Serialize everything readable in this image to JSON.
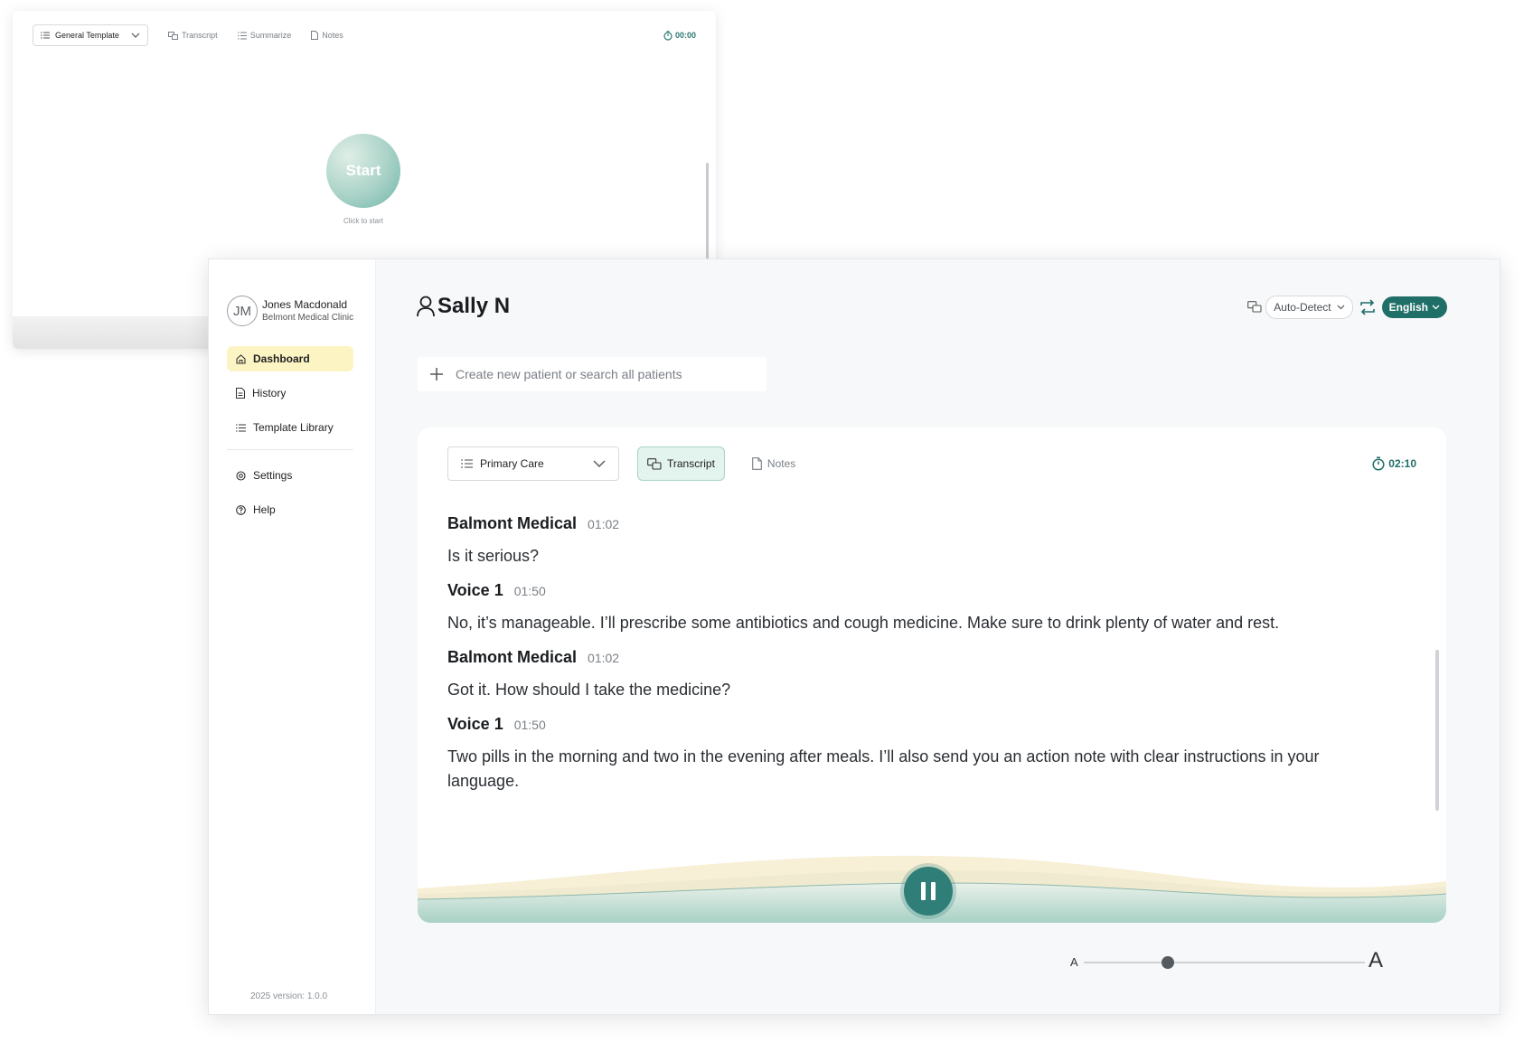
{
  "background_window": {
    "template_select": "General Template",
    "tabs": [
      {
        "label": "Transcript",
        "icon": "transcript-icon"
      },
      {
        "label": "Summarize",
        "icon": "list-icon"
      },
      {
        "label": "Notes",
        "icon": "document-icon"
      }
    ],
    "timer": "00:00",
    "start_button": "Start",
    "start_hint": "Click to start"
  },
  "sidebar": {
    "avatar_initials": "JM",
    "user_name": "Jones Macdonald",
    "clinic": "Belmont Medical Clinic",
    "nav": [
      {
        "label": "Dashboard",
        "icon": "home-icon",
        "active": true
      },
      {
        "label": "History",
        "icon": "history-icon",
        "active": false
      },
      {
        "label": "Template Library",
        "icon": "list-icon",
        "active": false
      }
    ],
    "nav_secondary": [
      {
        "label": "Settings",
        "icon": "gear-icon"
      },
      {
        "label": "Help",
        "icon": "help-icon"
      }
    ],
    "version": "2025 version: 1.0.0"
  },
  "header": {
    "patient_name": "Sally N",
    "source_language": "Auto-Detect",
    "target_language": "English"
  },
  "search": {
    "placeholder": "Create new patient or search all patients"
  },
  "card": {
    "template_select": "Primary Care",
    "tabs": [
      {
        "label": "Transcript",
        "active": true
      },
      {
        "label": "Notes",
        "active": false
      }
    ],
    "timer": "02:10",
    "transcript": [
      {
        "speaker": "Balmont Medical",
        "time": "01:02",
        "text": "Is it serious?"
      },
      {
        "speaker": "Voice 1",
        "time": "01:50",
        "text": "No, it’s manageable. I’ll prescribe some antibiotics and cough medicine. Make sure to drink plenty of water and rest."
      },
      {
        "speaker": "Balmont Medical",
        "time": "01:02",
        "text": "Got it. How should I take the medicine?"
      },
      {
        "speaker": "Voice 1",
        "time": "01:50",
        "text": "Two pills in the morning and two in the evening after meals. I’ll also send you an action note with clear instructions in your language."
      }
    ]
  },
  "font_size": {
    "small_label": "A",
    "large_label": "A",
    "level": 0.3
  },
  "colors": {
    "accent": "#1f6f68",
    "active_nav": "#fdf4c4",
    "active_tab": "#e3f3ee"
  }
}
